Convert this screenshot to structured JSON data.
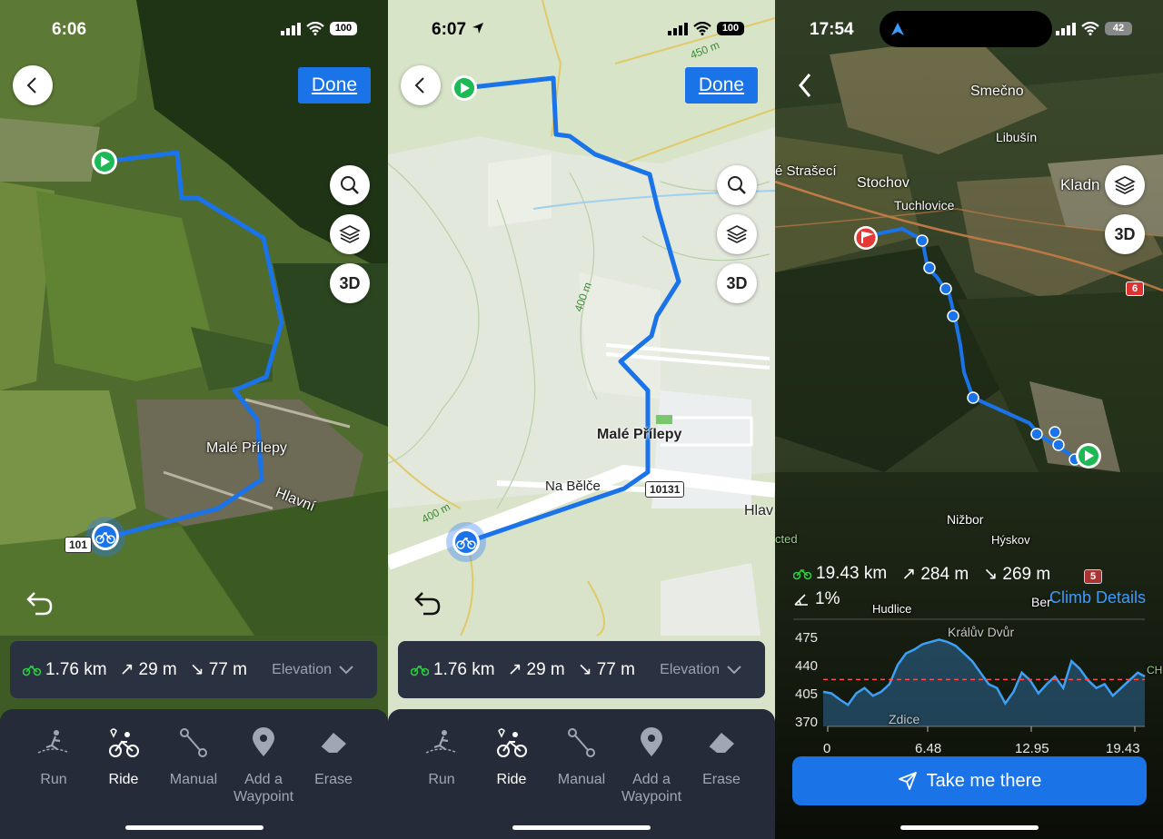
{
  "panel1": {
    "status": {
      "time": "6:06",
      "battery": "100"
    },
    "done_label": "Done",
    "map_labels": {
      "village": "Malé Přílepy",
      "road": "Hlavní",
      "road_number": "101"
    },
    "stats": {
      "distance": "1.76 km",
      "ascent": "29 m",
      "descent": "77 m",
      "elevation_label": "Elevation"
    },
    "tools": [
      {
        "label": "Run"
      },
      {
        "label": "Ride"
      },
      {
        "label": "Manual"
      },
      {
        "label": "Add a Waypoint"
      },
      {
        "label": "Erase"
      }
    ],
    "active_tool": "Ride",
    "zoom_3d_label": "3D"
  },
  "panel2": {
    "status": {
      "time": "6:07",
      "battery": "100"
    },
    "done_label": "Done",
    "map_labels": {
      "village": "Malé Přílepy",
      "street": "Na Bělče",
      "road": "Hlav",
      "road_number": "10131",
      "contour_450": "450 m",
      "contour_400a": "400 m",
      "contour_400b": "400 m"
    },
    "stats": {
      "distance": "1.76 km",
      "ascent": "29 m",
      "descent": "77 m",
      "elevation_label": "Elevation"
    },
    "tools": [
      {
        "label": "Run"
      },
      {
        "label": "Ride"
      },
      {
        "label": "Manual"
      },
      {
        "label": "Add a Waypoint"
      },
      {
        "label": "Erase"
      }
    ],
    "active_tool": "Ride",
    "zoom_3d_label": "3D"
  },
  "panel3": {
    "status": {
      "time": "17:54",
      "battery": "42"
    },
    "map_labels": {
      "smecno": "Smečno",
      "libusin": "Libušín",
      "strasec": "é Strašecí",
      "stochov": "Stochov",
      "tuchlovice": "Tuchlovice",
      "kladno": "Kladn",
      "nizbor": "Nižbor",
      "hyskov": "Hýskov",
      "hudlice": "Hudlice",
      "beroun": "Ber",
      "kraluv_dvur": "Králův Dvůr",
      "zdice": "Zdice",
      "cted": "cted",
      "ch": "CH",
      "road6": "6",
      "road5": "5"
    },
    "stats": {
      "distance": "19.43 km",
      "ascent": "284 m",
      "descent": "269 m",
      "grade": "1%"
    },
    "climb_details": "Climb Details",
    "zoom_3d_label": "3D",
    "take_me_there": "Take me there",
    "chart_data": {
      "type": "area",
      "x_ticks": [
        "0",
        "6.48",
        "12.95",
        "19.43"
      ],
      "y_ticks": [
        "475",
        "440",
        "405",
        "370"
      ],
      "xlim": [
        0,
        19.43
      ],
      "ylim": [
        355,
        485
      ],
      "reference_line": 416,
      "x": [
        0,
        0.5,
        1.0,
        1.5,
        2.0,
        2.5,
        3.0,
        3.5,
        4.0,
        4.5,
        5.0,
        5.5,
        6.0,
        6.5,
        7.0,
        7.5,
        8.0,
        8.5,
        9.0,
        9.5,
        10.0,
        10.5,
        11.0,
        11.5,
        12.0,
        12.5,
        13.0,
        13.5,
        14.0,
        14.5,
        15.0,
        15.5,
        16.0,
        16.5,
        17.0,
        17.5,
        18.0,
        18.5,
        19.0,
        19.43
      ],
      "values": [
        400,
        398,
        390,
        383,
        398,
        405,
        395,
        400,
        410,
        435,
        450,
        455,
        462,
        465,
        468,
        465,
        460,
        450,
        440,
        425,
        410,
        405,
        385,
        400,
        425,
        415,
        398,
        410,
        420,
        405,
        440,
        430,
        415,
        405,
        410,
        395,
        405,
        415,
        425,
        420
      ]
    }
  }
}
